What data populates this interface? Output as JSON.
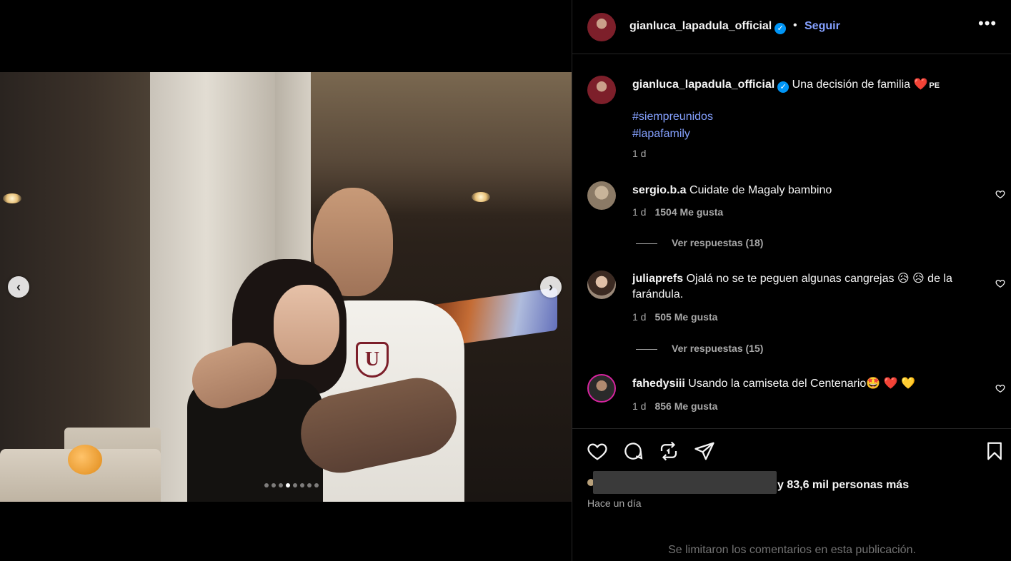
{
  "post": {
    "username": "gianluca_lapadula_official",
    "follow_label": "Seguir",
    "more_label": "•••",
    "separator": "•",
    "verified_mark": "✓",
    "caption": {
      "username": "gianluca_lapadula_official",
      "text": "Una decisión de familia",
      "emoji": "❤️",
      "flag": "PE",
      "hashtags": [
        "#siempreunidos",
        "#lapafamily"
      ],
      "time": "1 d"
    },
    "carousel": {
      "total": 8,
      "active_index": 3,
      "prev_label": "‹",
      "next_label": "›"
    }
  },
  "comments": [
    {
      "username": "sergio.b.a",
      "text": "Cuidate de Magaly bambino",
      "time": "1 d",
      "likes": "1504 Me gusta",
      "replies_label": "Ver respuestas (18)"
    },
    {
      "username": "juliaprefs",
      "text": "Ojalá no se te peguen algunas cangrejas 😥 😥  de la farándula.",
      "time": "1 d",
      "likes": "505 Me gusta",
      "replies_label": "Ver respuestas (15)"
    },
    {
      "username": "fahedysiii",
      "text": "Usando la camiseta del Centenario🤩 ❤️ 💛",
      "time": "1 d",
      "likes": "856 Me gusta"
    }
  ],
  "actions": {
    "likes_summary": "y 83,6 mil personas más",
    "post_time": "Hace un día",
    "comments_limited": "Se limitaron los comentarios en esta publicación."
  },
  "colors": {
    "background": "#000000",
    "link": "#85a1ff",
    "muted": "#a8a8a8",
    "verified": "#0095f6"
  },
  "icons": [
    "heart-icon",
    "comment-icon",
    "repost-icon",
    "share-icon",
    "bookmark-icon",
    "verified-icon",
    "more-icon"
  ]
}
